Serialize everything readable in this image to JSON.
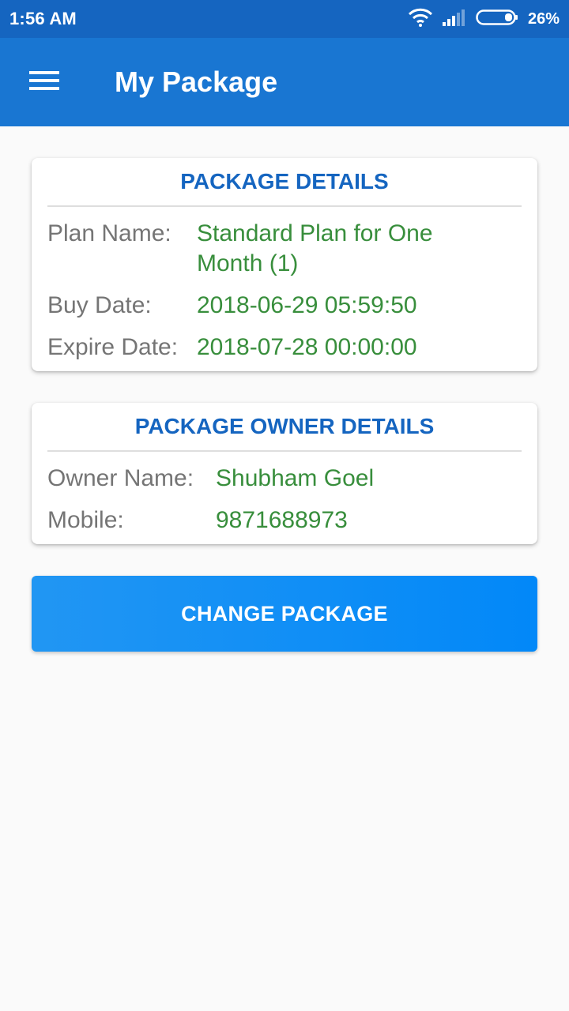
{
  "status_bar": {
    "time": "1:56 AM",
    "battery_percent": "26%",
    "icons": [
      "wifi-icon",
      "signal-icon",
      "battery-icon"
    ]
  },
  "app_bar": {
    "title": "My Package",
    "menu_icon": "menu-icon"
  },
  "package_details": {
    "heading": "PACKAGE DETAILS",
    "plan_name_label": "Plan Name:",
    "plan_name_line1": "Standard Plan for One",
    "plan_name_line2": "Month (1)",
    "buy_date_label": "Buy Date:",
    "buy_date": "2018-06-29 05:59:50",
    "expire_date_label": "Expire Date:",
    "expire_date": "2018-07-28 00:00:00"
  },
  "owner_details": {
    "heading": "PACKAGE OWNER DETAILS",
    "owner_name_label": "Owner Name:",
    "owner_name": "Shubham Goel",
    "mobile_label": "Mobile:",
    "mobile": "9871688973"
  },
  "actions": {
    "change_package_label": "CHANGE PACKAGE"
  },
  "colors": {
    "status_bar": "#1565c0",
    "app_bar": "#1976d2",
    "heading": "#1565c0",
    "label": "#757575",
    "value": "#388e3c",
    "button": "#2196f3"
  }
}
